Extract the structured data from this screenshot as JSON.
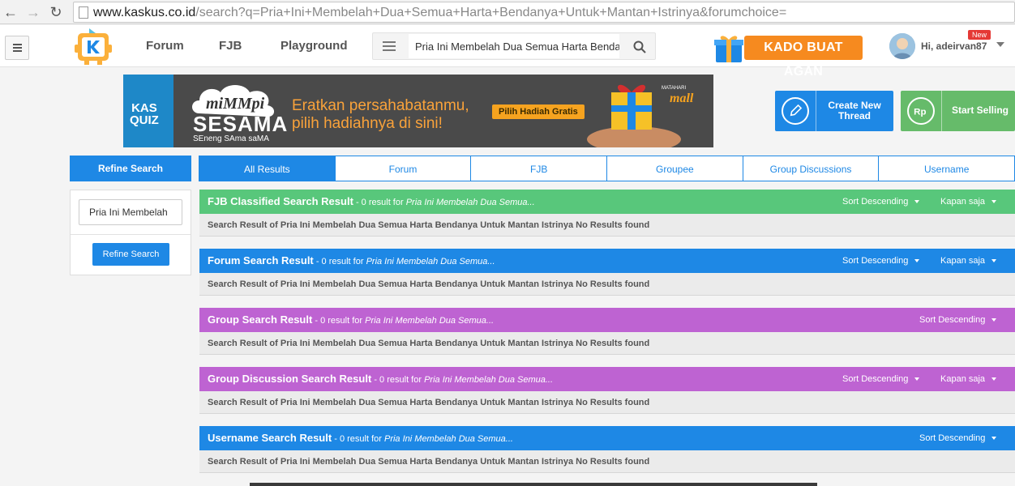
{
  "browser": {
    "url_host": "www.kaskus.co.id",
    "url_rest": "/search?q=Pria+Ini+Membelah+Dua+Semua+Harta+Bendanya+Untuk+Mantan+Istrinya&forumchoice="
  },
  "header": {
    "nav": [
      "Forum",
      "FJB",
      "Playground"
    ],
    "search_value": "Pria Ini Membelah Dua Semua Harta Bendan",
    "promo_label": "KADO BUAT AGAN",
    "greeting": "Hi, adeirvan87",
    "new_badge": "New"
  },
  "ad": {
    "left_label_1": "KAS",
    "left_label_2": "QUIZ",
    "brand_script": "miMMpi",
    "brand_main": "SESAMA",
    "brand_sub": "SEneng SAma saMA",
    "tagline_1": "Eratkan persahabatanmu,",
    "tagline_2": "pilih hadiahnya di sini!",
    "cta": "Pilih Hadiah Gratis",
    "sponsor": "MATAHARI mall"
  },
  "actions": {
    "create_line1": "Create New",
    "create_line2": "Thread",
    "sell": "Start Selling"
  },
  "refine": {
    "header": "Refine Search",
    "input_value": "Pria Ini Membelah",
    "button": "Refine Search"
  },
  "tabs": [
    "All Results",
    "Forum",
    "FJB",
    "Groupee",
    "Group Discussions",
    "Username"
  ],
  "results": [
    {
      "title": "FJB Classified Search Result",
      "count": " - 0 result for ",
      "query": "Pria Ini Membelah Dua Semua...",
      "sort": "Sort Descending",
      "time": "Kapan saja",
      "message": "Search Result of Pria Ini Membelah Dua Semua Harta Bendanya Untuk Mantan Istrinya No Results found"
    },
    {
      "title": "Forum Search Result",
      "count": " - 0 result for ",
      "query": "Pria Ini Membelah Dua Semua...",
      "sort": "Sort Descending",
      "time": "Kapan saja",
      "message": "Search Result of Pria Ini Membelah Dua Semua Harta Bendanya Untuk Mantan Istrinya No Results found"
    },
    {
      "title": "Group Search Result",
      "count": " - 0 result for ",
      "query": "Pria Ini Membelah Dua Semua...",
      "sort": "Sort Descending",
      "message": "Search Result of Pria Ini Membelah Dua Semua Harta Bendanya Untuk Mantan Istrinya No Results found"
    },
    {
      "title": "Group Discussion Search Result",
      "count": " - 0 result for ",
      "query": "Pria Ini Membelah Dua Semua...",
      "sort": "Sort Descending",
      "time": "Kapan saja",
      "message": "Search Result of Pria Ini Membelah Dua Semua Harta Bendanya Untuk Mantan Istrinya No Results found"
    },
    {
      "title": "Username Search Result",
      "count": " - 0 result for ",
      "query": "Pria Ini Membelah Dua Semua...",
      "sort": "Sort Descending",
      "message": "Search Result of Pria Ini Membelah Dua Semua Harta Bendanya Untuk Mantan Istrinya No Results found"
    }
  ],
  "colors": {
    "brand_blue": "#1e88e5",
    "fjb_green": "#58c77b",
    "group_purple": "#be63d2",
    "sell_green": "#66bb6a",
    "promo_orange": "#f68a1f"
  }
}
